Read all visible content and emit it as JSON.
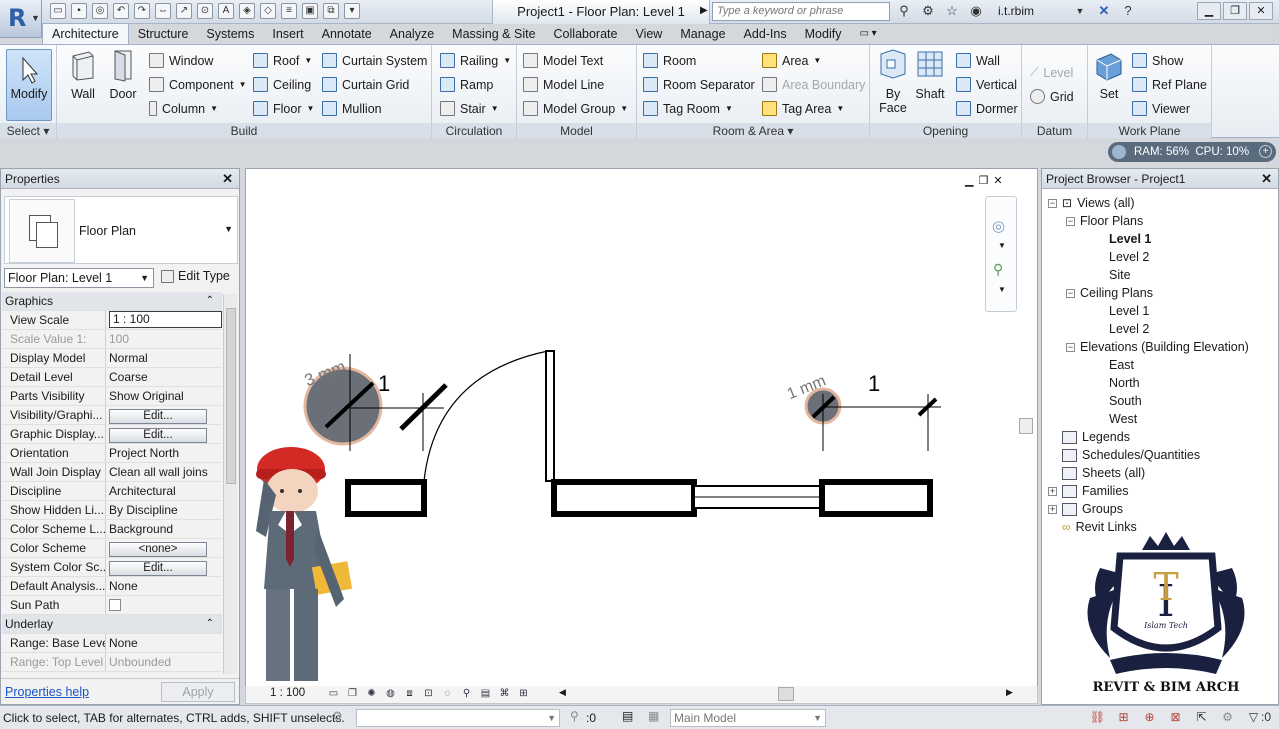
{
  "app": {
    "logo_letter": "R",
    "document_title": "Project1 - Floor Plan: Level 1",
    "search_placeholder": "Type a keyword or phrase",
    "user": "i.t.rbim"
  },
  "tabs": [
    "Architecture",
    "Structure",
    "Systems",
    "Insert",
    "Annotate",
    "Analyze",
    "Massing & Site",
    "Collaborate",
    "View",
    "Manage",
    "Add-Ins",
    "Modify"
  ],
  "ribbon": {
    "select": {
      "button": "Modify",
      "title": "Select"
    },
    "build": {
      "title": "Build",
      "wall": "Wall",
      "door": "Door",
      "window": "Window",
      "component": "Component",
      "column": "Column",
      "roof": "Roof",
      "ceiling": "Ceiling",
      "floor": "Floor",
      "curtain_system": "Curtain System",
      "curtain_grid": "Curtain Grid",
      "mullion": "Mullion"
    },
    "circulation": {
      "title": "Circulation",
      "railing": "Railing",
      "ramp": "Ramp",
      "stair": "Stair"
    },
    "model": {
      "title": "Model",
      "text": "Model Text",
      "line": "Model Line",
      "group": "Model Group"
    },
    "room_area": {
      "title": "Room & Area",
      "room": "Room",
      "room_sep": "Room Separator",
      "tag_room": "Tag Room",
      "area": "Area",
      "area_boundary": "Area Boundary",
      "tag_area": "Tag Area"
    },
    "opening": {
      "title": "Opening",
      "by_face_1": "By",
      "by_face_2": "Face",
      "shaft": "Shaft",
      "wall": "Wall",
      "vertical": "Vertical",
      "dormer": "Dormer"
    },
    "datum": {
      "title": "Datum",
      "level": "Level",
      "grid": "Grid"
    },
    "workplane": {
      "title": "Work Plane",
      "set": "Set",
      "show": "Show",
      "ref_plane": "Ref Plane",
      "viewer": "Viewer"
    }
  },
  "perf": {
    "ram": "RAM: 56%",
    "cpu": "CPU: 10%"
  },
  "properties": {
    "title": "Properties",
    "type_name": "Floor Plan",
    "instance": "Floor Plan: Level 1",
    "edit_type": "Edit Type",
    "sec_graphics": "Graphics",
    "sec_underlay": "Underlay",
    "rows": [
      {
        "k": "View Scale",
        "v": "1 : 100"
      },
      {
        "k": "Scale Value    1:",
        "v": "100"
      },
      {
        "k": "Display Model",
        "v": "Normal"
      },
      {
        "k": "Detail Level",
        "v": "Coarse"
      },
      {
        "k": "Parts Visibility",
        "v": "Show Original"
      },
      {
        "k": "Visibility/Graphi...",
        "v": "Edit..."
      },
      {
        "k": "Graphic Display...",
        "v": "Edit..."
      },
      {
        "k": "Orientation",
        "v": "Project North"
      },
      {
        "k": "Wall Join Display",
        "v": "Clean all wall joins"
      },
      {
        "k": "Discipline",
        "v": "Architectural"
      },
      {
        "k": "Show Hidden Li...",
        "v": "By Discipline"
      },
      {
        "k": "Color Scheme L...",
        "v": "Background"
      },
      {
        "k": "Color Scheme",
        "v": "<none>"
      },
      {
        "k": "System Color Sc...",
        "v": "Edit..."
      },
      {
        "k": "Default Analysis...",
        "v": "None"
      },
      {
        "k": "Sun Path",
        "v": ""
      }
    ],
    "underlay_rows": [
      {
        "k": "Range: Base Level",
        "v": "None"
      },
      {
        "k": "Range: Top Level",
        "v": "Unbounded"
      }
    ],
    "help": "Properties help",
    "apply": "Apply"
  },
  "canvas": {
    "dim1": "3 mm",
    "num1": "1",
    "dim2": "1 mm",
    "num2": "1",
    "scale": "1 : 100"
  },
  "browser": {
    "title": "Project Browser - Project1",
    "views_all": "Views (all)",
    "floor_plans": "Floor Plans",
    "fp": [
      "Level 1",
      "Level 2",
      "Site"
    ],
    "ceiling_plans": "Ceiling Plans",
    "cp": [
      "Level 1",
      "Level 2"
    ],
    "elevations": "Elevations (Building Elevation)",
    "el": [
      "East",
      "North",
      "South",
      "West"
    ],
    "legends": "Legends",
    "schedules": "Schedules/Quantities",
    "sheets": "Sheets (all)",
    "families": "Families",
    "groups": "Groups",
    "links": "Revit Links"
  },
  "logo": {
    "brand": "REVIT & BIM ARCH",
    "subtitle": "Islam Tech"
  },
  "status": {
    "message": "Click to select, TAB for alternates, CTRL adds, SHIFT unselects.",
    "workset": ":0",
    "model": "Main Model",
    "filter": ":0"
  }
}
